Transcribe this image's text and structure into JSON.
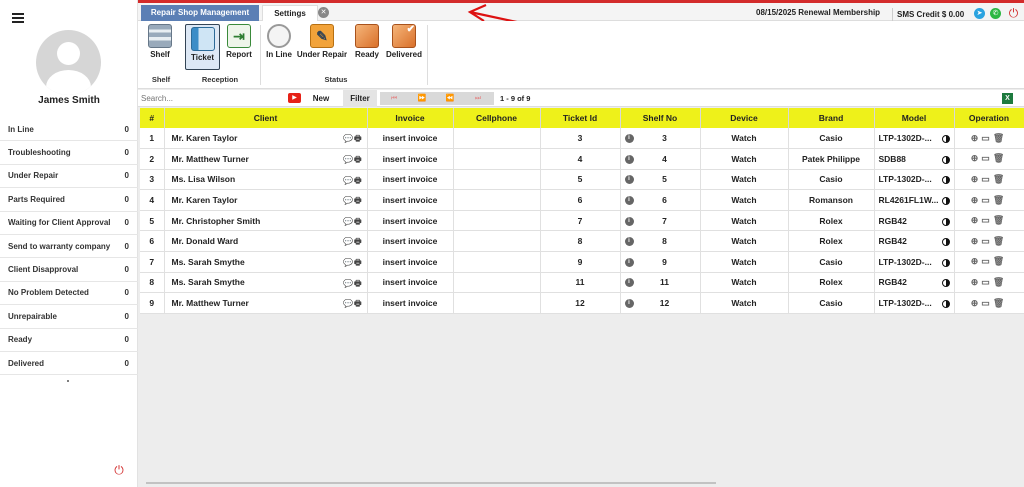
{
  "user": {
    "name": "James Smith"
  },
  "sidebar": {
    "statuses": [
      {
        "label": "In Line",
        "count": "0"
      },
      {
        "label": "Troubleshooting",
        "count": "0"
      },
      {
        "label": "Under Repair",
        "count": "0"
      },
      {
        "label": "Parts Required",
        "count": "0"
      },
      {
        "label": "Waiting for Client Approval",
        "count": "0"
      },
      {
        "label": "Send to warranty company",
        "count": "0"
      },
      {
        "label": "Client Disapproval",
        "count": "0"
      },
      {
        "label": "No Problem Detected",
        "count": "0"
      },
      {
        "label": "Unrepairable",
        "count": "0"
      },
      {
        "label": "Ready",
        "count": "0"
      },
      {
        "label": "Delivered",
        "count": "0"
      }
    ],
    "footer_dot": "."
  },
  "tabs": {
    "active": "Repair Shop Management",
    "settings": "Settings"
  },
  "header": {
    "renewal": "08/15/2025 Renewal Membership",
    "sms_credit": "SMS Credit $ 0.00"
  },
  "ribbon": {
    "shelf_button": "Shelf",
    "ticket_button": "Ticket",
    "report_button": "Report",
    "inline_button": "In Line",
    "underrepair_button": "Under Repair",
    "ready_button": "Ready",
    "delivered_button": "Delivered",
    "group_shelf": "Shelf",
    "group_reception": "Reception",
    "group_status": "Status"
  },
  "toolbar": {
    "search_placeholder": "Search...",
    "new_label": "New",
    "filter_label": "Filter",
    "page_info": "1 - 9 of 9"
  },
  "table": {
    "columns": [
      "#",
      "Client",
      "Invoice",
      "Cellphone",
      "Ticket Id",
      "Shelf No",
      "Device",
      "Brand",
      "Model",
      "Operation"
    ],
    "rows": [
      {
        "n": "1",
        "client": "Mr. Karen Taylor",
        "invoice": "insert invoice",
        "cellphone": "",
        "ticket": "3",
        "shelf": "3",
        "device": "Watch",
        "brand": "Casio",
        "model": "LTP-1302D-..."
      },
      {
        "n": "2",
        "client": "Mr. Matthew Turner",
        "invoice": "insert invoice",
        "cellphone": "",
        "ticket": "4",
        "shelf": "4",
        "device": "Watch",
        "brand": "Patek Philippe",
        "model": "SDB88"
      },
      {
        "n": "3",
        "client": "Ms. Lisa Wilson",
        "invoice": "insert invoice",
        "cellphone": "",
        "ticket": "5",
        "shelf": "5",
        "device": "Watch",
        "brand": "Casio",
        "model": "LTP-1302D-..."
      },
      {
        "n": "4",
        "client": "Mr. Karen Taylor",
        "invoice": "insert invoice",
        "cellphone": "",
        "ticket": "6",
        "shelf": "6",
        "device": "Watch",
        "brand": "Romanson",
        "model": "RL4261FL1W..."
      },
      {
        "n": "5",
        "client": "Mr. Christopher Smith",
        "invoice": "insert invoice",
        "cellphone": "",
        "ticket": "7",
        "shelf": "7",
        "device": "Watch",
        "brand": "Rolex",
        "model": "RGB42"
      },
      {
        "n": "6",
        "client": "Mr. Donald Ward",
        "invoice": "insert invoice",
        "cellphone": "",
        "ticket": "8",
        "shelf": "8",
        "device": "Watch",
        "brand": "Rolex",
        "model": "RGB42"
      },
      {
        "n": "7",
        "client": "Ms. Sarah Smythe",
        "invoice": "insert invoice",
        "cellphone": "",
        "ticket": "9",
        "shelf": "9",
        "device": "Watch",
        "brand": "Casio",
        "model": "LTP-1302D-..."
      },
      {
        "n": "8",
        "client": "Ms. Sarah Smythe",
        "invoice": "insert invoice",
        "cellphone": "",
        "ticket": "11",
        "shelf": "11",
        "device": "Watch",
        "brand": "Rolex",
        "model": "RGB42"
      },
      {
        "n": "9",
        "client": "Mr. Matthew Turner",
        "invoice": "insert invoice",
        "cellphone": "",
        "ticket": "12",
        "shelf": "12",
        "device": "Watch",
        "brand": "Casio",
        "model": "LTP-1302D-..."
      }
    ]
  },
  "colors": {
    "accent_red": "#d32b2b",
    "tab_blue": "#5b7fb5",
    "header_yellow": "#eef11a"
  }
}
